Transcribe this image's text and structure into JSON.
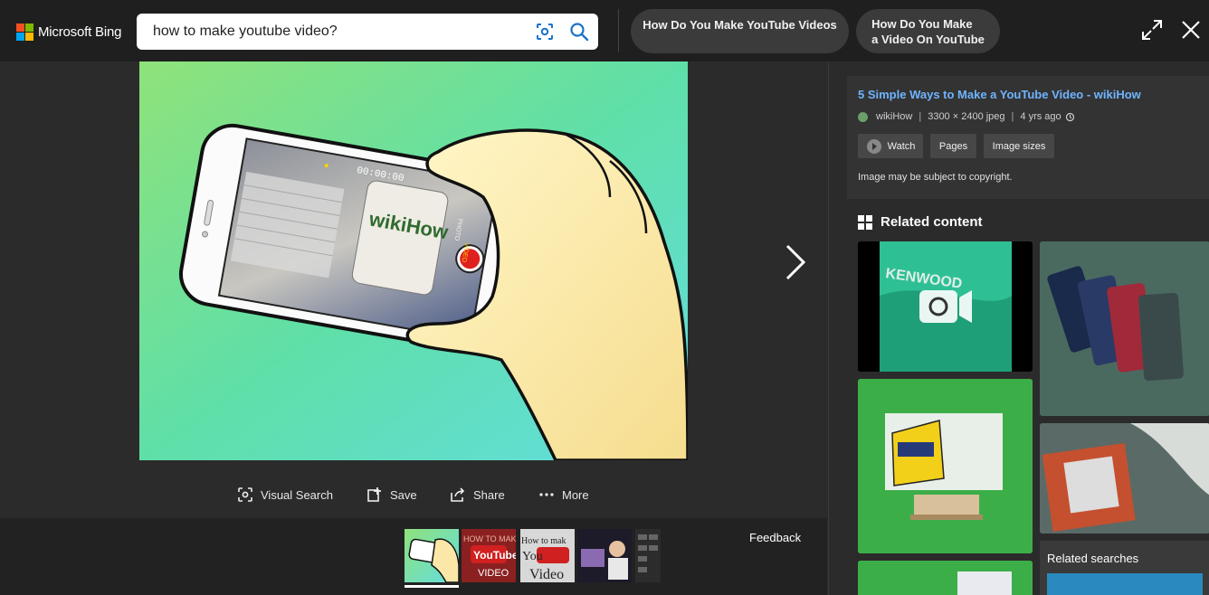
{
  "brand": {
    "name": "Microsoft Bing",
    "logo_colors": [
      "#f25022",
      "#7fba00",
      "#00a4ef",
      "#ffb900"
    ]
  },
  "search": {
    "query": "how to make youtube video?",
    "visual_search_icon": "visual-search-icon",
    "search_icon": "search-icon"
  },
  "chips": [
    {
      "label": "How Do You Make YouTube Videos"
    },
    {
      "line1": "How Do You Make",
      "line2": "a Video On YouTube"
    }
  ],
  "window": {
    "expand_icon": "expand-icon",
    "close_icon": "close-icon"
  },
  "main_image": {
    "alt": "Hand holding a phone recording a wikiHow mug",
    "camera_time": "00:00:00",
    "mug_text": "wikiHow",
    "side_label_1": "PHOTO",
    "side_label_2": "VIDEO"
  },
  "actions": [
    {
      "label": "Visual Search",
      "icon": "visual-search-icon"
    },
    {
      "label": "Save",
      "icon": "save-icon"
    },
    {
      "label": "Share",
      "icon": "share-icon"
    },
    {
      "label": "More",
      "icon": "more-icon"
    }
  ],
  "filmstrip": {
    "feedback": "Feedback",
    "thumbs": [
      {
        "caption": ""
      },
      {
        "caption": "HOW TO MAKE YouTube VIDEO"
      },
      {
        "caption": "How to make YouTube Video"
      },
      {
        "caption": ""
      },
      {
        "caption": ""
      }
    ]
  },
  "info": {
    "title": "5 Simple Ways to Make a YouTube Video - wikiHow",
    "site": "wikiHow",
    "dimensions": "3300 × 2400 jpeg",
    "age": "4 yrs ago",
    "separator": "|",
    "buttons": [
      "Watch",
      "Pages",
      "Image sizes"
    ],
    "copyright": "Image may be subject to copyright."
  },
  "related": {
    "heading": "Related content",
    "searches_title": "Related searches",
    "items": [
      {
        "caption": "KENWOOD"
      },
      {
        "caption": ""
      },
      {
        "caption": ""
      },
      {
        "caption": ""
      },
      {
        "caption": ""
      }
    ]
  },
  "colors": {
    "bg": "#2b2b2b",
    "topbar": "#1f1f1f",
    "link": "#6fb4ff",
    "chip": "#3b3b3b"
  }
}
